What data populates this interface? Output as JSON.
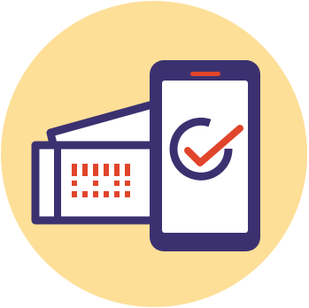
{
  "illustration": {
    "subject": "mobile-ticket-verified-icon",
    "colors": {
      "background": "#ffffff",
      "circle": "#fddf98",
      "outline": "#3c3170",
      "accent": "#e0452b",
      "paper": "#ffffff"
    },
    "icons": [
      "ticket-back-icon",
      "ticket-front-icon",
      "barcode-icon",
      "smartphone-icon",
      "checkmark-circle-icon"
    ]
  }
}
